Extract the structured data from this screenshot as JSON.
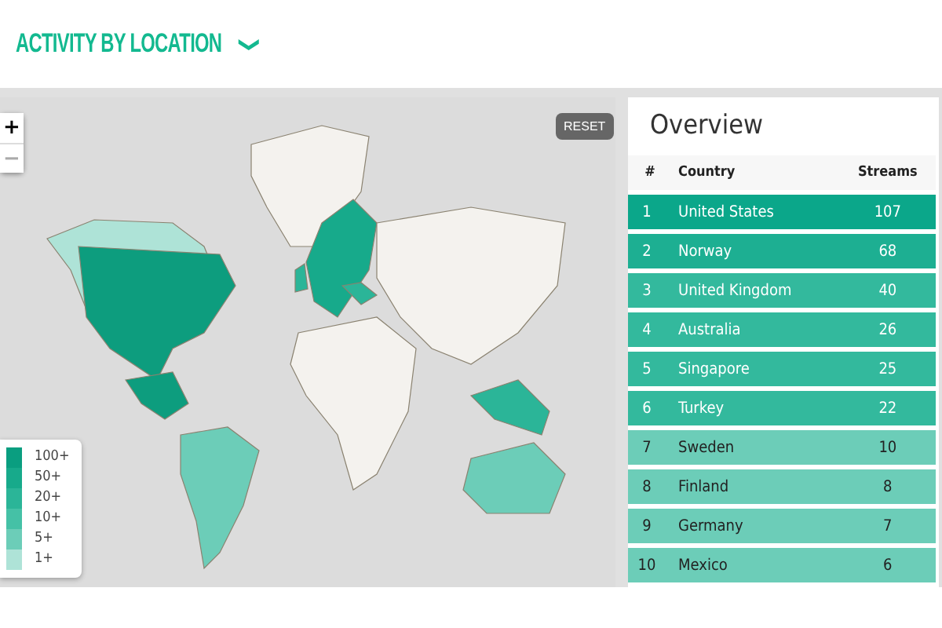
{
  "header": {
    "title": "ACTIVITY BY LOCATION",
    "toggle": "❯"
  },
  "map": {
    "zoom_in": "+",
    "zoom_out": "−",
    "zoom_out_disabled": true,
    "reset": "RESET",
    "legend": [
      {
        "label": "100+",
        "color": "#0a9e80"
      },
      {
        "label": "50+",
        "color": "#17aa8b"
      },
      {
        "label": "20+",
        "color": "#2bb598"
      },
      {
        "label": "10+",
        "color": "#45c1a6"
      },
      {
        "label": "5+",
        "color": "#6ccdb8"
      },
      {
        "label": "1+",
        "color": "#aee3d7"
      }
    ]
  },
  "overview": {
    "title": "Overview",
    "columns": [
      "#",
      "Country",
      "Streams"
    ],
    "rows": [
      {
        "rank": "1",
        "country": "United States",
        "streams": "107",
        "color": "#0ba78a"
      },
      {
        "rank": "2",
        "country": "Norway",
        "streams": "68",
        "color": "#1daf92"
      },
      {
        "rank": "3",
        "country": "United Kingdom",
        "streams": "40",
        "color": "#33b99d"
      },
      {
        "rank": "4",
        "country": "Australia",
        "streams": "26",
        "color": "#33b99d"
      },
      {
        "rank": "5",
        "country": "Singapore",
        "streams": "25",
        "color": "#33b99d"
      },
      {
        "rank": "6",
        "country": "Turkey",
        "streams": "22",
        "color": "#33b99d"
      },
      {
        "rank": "7",
        "country": "Sweden",
        "streams": "10",
        "color": "#6ccdb8"
      },
      {
        "rank": "8",
        "country": "Finland",
        "streams": "8",
        "color": "#6ccdb8"
      },
      {
        "rank": "9",
        "country": "Germany",
        "streams": "7",
        "color": "#6ccdb8"
      },
      {
        "rank": "10",
        "country": "Mexico",
        "streams": "6",
        "color": "#6ccdb8"
      }
    ]
  }
}
